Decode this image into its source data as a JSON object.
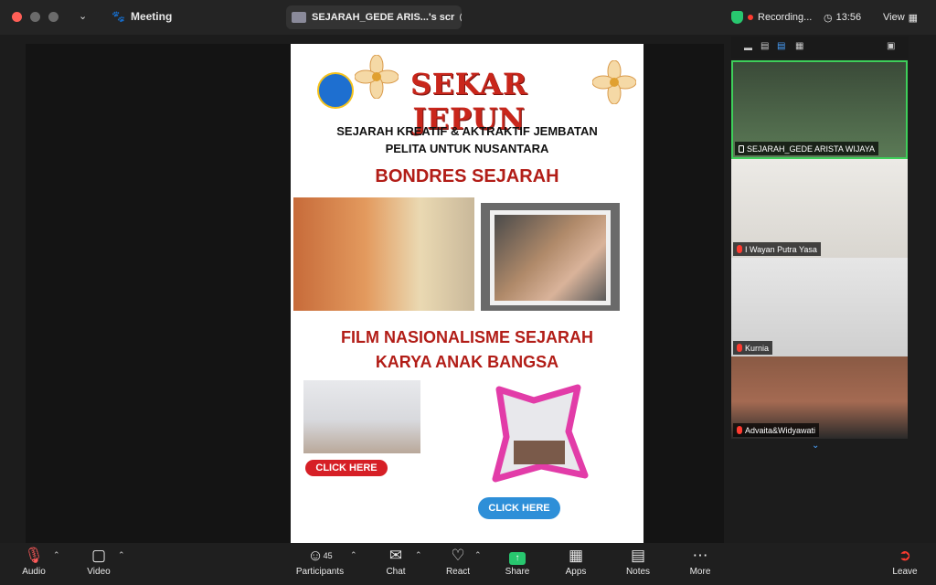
{
  "topbar": {
    "meeting_label": "Meeting",
    "share_tab_label": "SEJARAH_GEDE ARIS...'s scr",
    "recording_label": "Recording...",
    "time": "13:56",
    "view_label": "View"
  },
  "slide": {
    "title": "SEKAR JEPUN",
    "subtitle_line1": "SEJARAH KREATIF &  AKTRAKTIF JEMBATAN",
    "subtitle_line2": "PELITA UNTUK NUSANTARA",
    "heading1": "BONDRES SEJARAH",
    "heading2_line1": "FILM NASIONALISME SEJARAH",
    "heading2_line2": "KARYA ANAK BANGSA",
    "click_here_1": "CLICK HERE",
    "click_here_2": "CLICK HERE"
  },
  "participants": [
    {
      "name": "SEJARAH_GEDE ARISTA WIJAYA",
      "muted": false,
      "pinned": true
    },
    {
      "name": "I Wayan Putra Yasa",
      "muted": true
    },
    {
      "name": "Kurnia",
      "muted": true
    },
    {
      "name": "Advaita&Widyawati",
      "muted": true
    }
  ],
  "toolbar": {
    "audio": "Audio",
    "video": "Video",
    "participants": "Participants",
    "participants_count": "45",
    "chat": "Chat",
    "react": "React",
    "share": "Share",
    "apps": "Apps",
    "notes": "Notes",
    "more": "More",
    "leave": "Leave"
  },
  "colors": {
    "speaker_border": "#3ecf5a",
    "share_green": "#28c76f",
    "leave_red": "#ff3b30"
  }
}
